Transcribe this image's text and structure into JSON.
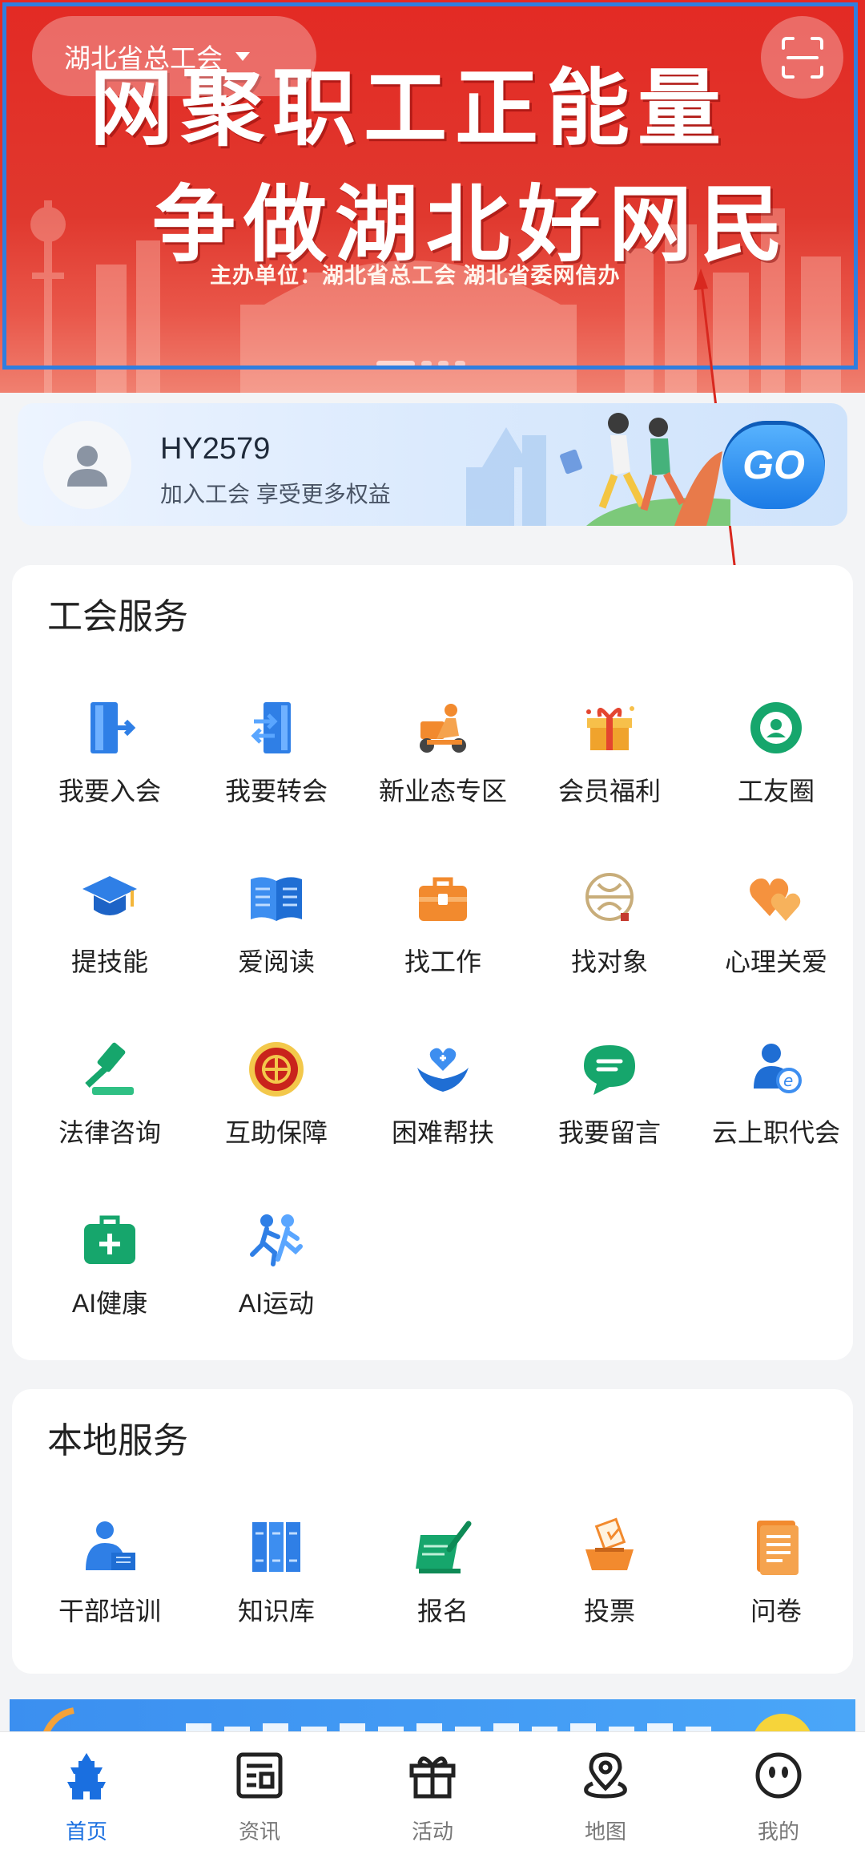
{
  "banner": {
    "region": "湖北省总工会",
    "line1": "网聚职工正能量",
    "line2": "争做湖北好网民",
    "sponsor": "主办单位：湖北省总工会 湖北省委网信办"
  },
  "member": {
    "username": "HY2579",
    "tip": "加入工会 享受更多权益",
    "go_label": "GO"
  },
  "union_services": {
    "title": "工会服务",
    "items": [
      {
        "label": "我要入会",
        "icon": "door-enter-icon"
      },
      {
        "label": "我要转会",
        "icon": "door-transfer-icon"
      },
      {
        "label": "新业态专区",
        "icon": "delivery-rider-icon"
      },
      {
        "label": "会员福利",
        "icon": "gift-box-icon"
      },
      {
        "label": "工友圈",
        "icon": "camera-lens-icon"
      },
      {
        "label": "提技能",
        "icon": "graduation-cap-icon"
      },
      {
        "label": "爱阅读",
        "icon": "open-book-icon"
      },
      {
        "label": "找工作",
        "icon": "briefcase-icon"
      },
      {
        "label": "找对象",
        "icon": "matchmaking-emblem-icon"
      },
      {
        "label": "心理关爱",
        "icon": "hearts-icon"
      },
      {
        "label": "法律咨询",
        "icon": "gavel-icon"
      },
      {
        "label": "互助保障",
        "icon": "union-emblem-icon"
      },
      {
        "label": "困难帮扶",
        "icon": "care-hands-icon"
      },
      {
        "label": "我要留言",
        "icon": "chat-bubble-icon"
      },
      {
        "label": "云上职代会",
        "icon": "online-user-icon"
      },
      {
        "label": "AI健康",
        "icon": "medical-kit-icon"
      },
      {
        "label": "AI运动",
        "icon": "running-people-icon"
      }
    ]
  },
  "local_services": {
    "title": "本地服务",
    "items": [
      {
        "label": "干部培训",
        "icon": "trainer-icon"
      },
      {
        "label": "知识库",
        "icon": "binders-icon"
      },
      {
        "label": "报名",
        "icon": "signup-pen-icon"
      },
      {
        "label": "投票",
        "icon": "ballot-box-icon"
      },
      {
        "label": "问卷",
        "icon": "questionnaire-icon"
      }
    ]
  },
  "tabbar": [
    {
      "label": "首页",
      "icon": "home-tower-icon",
      "active": true
    },
    {
      "label": "资讯",
      "icon": "news-icon",
      "active": false
    },
    {
      "label": "活动",
      "icon": "gift-activity-icon",
      "active": false
    },
    {
      "label": "地图",
      "icon": "map-pin-icon",
      "active": false
    },
    {
      "label": "我的",
      "icon": "profile-face-icon",
      "active": false
    }
  ],
  "colors": {
    "banner_red": "#e32a24",
    "tab_active": "#1a6fe0",
    "go_blue": "#1b7be6"
  }
}
